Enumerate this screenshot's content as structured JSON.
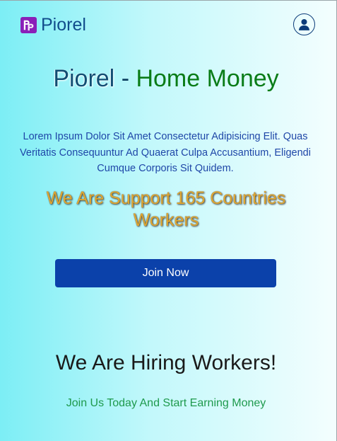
{
  "header": {
    "brand_name": "Piorel",
    "logo_icon": "piorel-logo-icon",
    "profile_icon": "user-profile-icon"
  },
  "hero": {
    "title_part1": "Piorel",
    "title_separator": " - ",
    "title_part2": "Home Money",
    "description": "Lorem Ipsum Dolor Sit Amet Consectetur Adipisicing Elit. Quas Veritatis Consequuntur Ad Quaerat Culpa Accusantium, Eligendi Cumque Corporis Sit Quidem.",
    "support_text": "We Are Support 165 Countries Workers",
    "join_button_label": "Join Now"
  },
  "hiring": {
    "title": "We Are Hiring Workers!",
    "subtitle": "Join Us Today And Start Earning Money"
  },
  "colors": {
    "brand_blue": "#114d8c",
    "logo_purple": "#8a1fb8",
    "button_blue": "#0b41aa",
    "title_green": "#0a7c17",
    "support_gold": "#e0a730",
    "subtitle_green": "#1f9a4d"
  }
}
